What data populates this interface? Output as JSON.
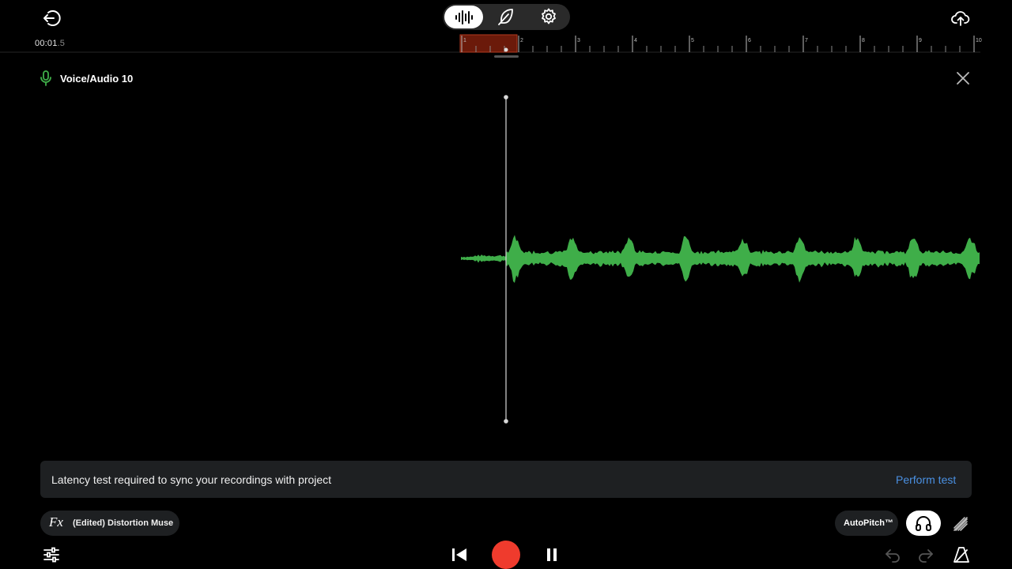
{
  "header": {
    "back_icon": "back-arrow-icon",
    "modes": [
      {
        "name": "waveform",
        "icon": "waveform-icon",
        "active": true
      },
      {
        "name": "feather",
        "icon": "feather-icon",
        "active": false
      },
      {
        "name": "settings",
        "icon": "gear-icon",
        "active": false
      }
    ],
    "upload_icon": "cloud-upload-icon"
  },
  "timeline": {
    "time_main": "00:01",
    "time_frac": ".5",
    "ruler_labels": [
      "1",
      "2",
      "3",
      "4",
      "5",
      "6",
      "7",
      "8",
      "9",
      "10"
    ],
    "loop_region_color": "#6b1a0a"
  },
  "track": {
    "icon": "microphone-icon",
    "name": "Voice/Audio 10",
    "accent_color": "#3fae49",
    "close_icon": "close-icon"
  },
  "banner": {
    "message": "Latency test required to sync your recordings with project",
    "action": "Perform test"
  },
  "bottom": {
    "fx_label": "Fx",
    "fx_name": "(Edited) Distortion Muse",
    "autopitch": "AutoPitch™",
    "monitor_icon": "headphones-icon",
    "mute_monitor_icon": "headphones-off-icon",
    "mixer_icon": "sliders-icon",
    "transport": {
      "skip_back_icon": "skip-back-icon",
      "record_icon": "record-icon",
      "record_color": "#ef3b2d",
      "pause_icon": "pause-icon"
    },
    "undo_icon": "undo-icon",
    "redo_icon": "redo-icon",
    "metronome_icon": "metronome-icon"
  }
}
